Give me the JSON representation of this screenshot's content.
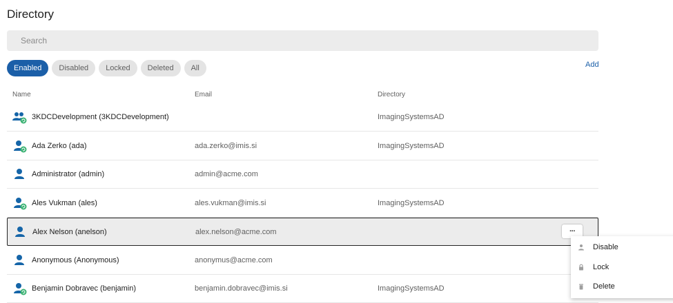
{
  "page": {
    "title": "Directory"
  },
  "search": {
    "placeholder": "Search"
  },
  "filters": {
    "chips": [
      "Enabled",
      "Disabled",
      "Locked",
      "Deleted",
      "All"
    ],
    "active": "Enabled"
  },
  "add_label": "Add",
  "columns": {
    "name": "Name",
    "email": "Email",
    "directory": "Directory"
  },
  "rows": [
    {
      "name": "3KDCDevelopment (3KDCDevelopment)",
      "email": "",
      "directory": "ImagingSystemsAD",
      "icon": "group-synced-icon"
    },
    {
      "name": "Ada Zerko (ada)",
      "email": "ada.zerko@imis.si",
      "directory": "ImagingSystemsAD",
      "icon": "user-synced-icon"
    },
    {
      "name": "Administrator (admin)",
      "email": "admin@acme.com",
      "directory": "",
      "icon": "user-icon"
    },
    {
      "name": "Ales Vukman (ales)",
      "email": "ales.vukman@imis.si",
      "directory": "ImagingSystemsAD",
      "icon": "user-synced-icon"
    },
    {
      "name": "Alex Nelson (anelson)",
      "email": "alex.nelson@acme.com",
      "directory": "",
      "icon": "user-icon",
      "selected": true
    },
    {
      "name": "Anonymous (Anonymous)",
      "email": "anonymus@acme.com",
      "directory": "",
      "icon": "user-icon"
    },
    {
      "name": "Benjamin Dobravec (benjamin)",
      "email": "benjamin.dobravec@imis.si",
      "directory": "ImagingSystemsAD",
      "icon": "user-synced-icon"
    }
  ],
  "row_menu": {
    "button_label": "···",
    "items": [
      {
        "label": "Disable",
        "icon": "person-icon"
      },
      {
        "label": "Lock",
        "icon": "lock-icon"
      },
      {
        "label": "Delete",
        "icon": "trash-icon"
      }
    ]
  },
  "colors": {
    "accent": "#1b5fa8",
    "icon_blue": "#1565a8",
    "sync_green": "#3bb273"
  }
}
